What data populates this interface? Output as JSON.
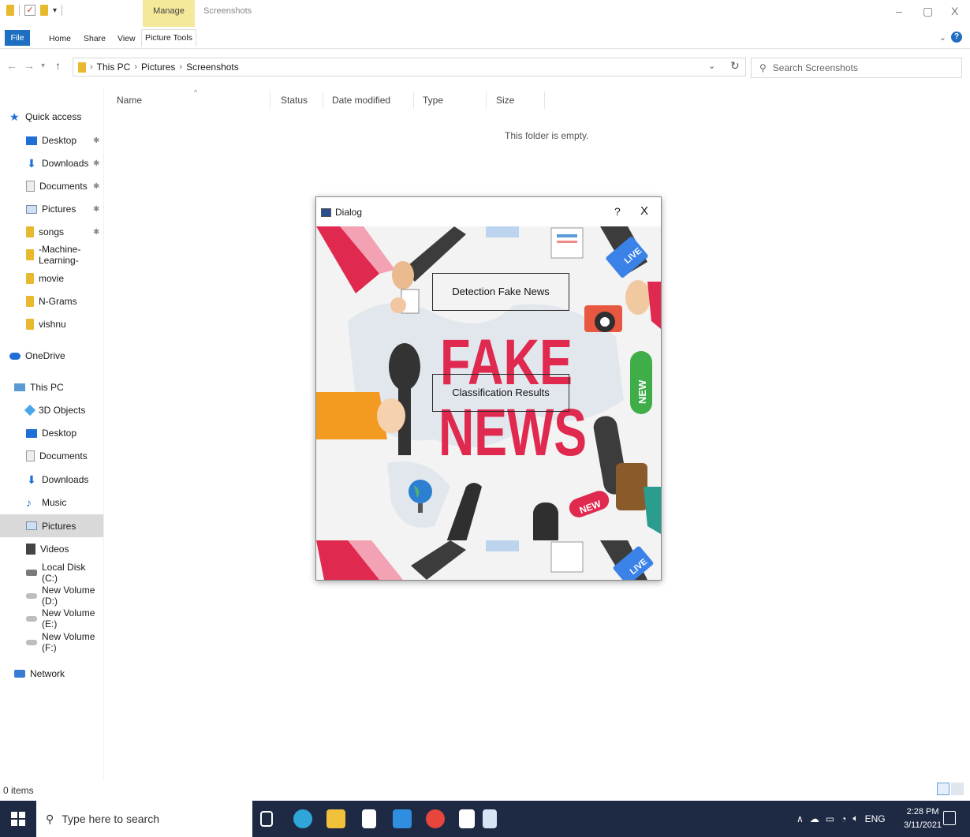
{
  "window": {
    "contextual_tab": "Manage",
    "title": "Screenshots",
    "controls": {
      "minimize": "–",
      "maximize": "▢",
      "close": "X"
    }
  },
  "ribbon": {
    "tabs": [
      "File",
      "Home",
      "Share",
      "View",
      "Picture Tools"
    ],
    "expand_icon": "chevron-down-icon",
    "help_icon": "?"
  },
  "address_bar": {
    "path": [
      "This PC",
      "Pictures",
      "Screenshots"
    ],
    "search_placeholder": "Search Screenshots"
  },
  "sidebar": {
    "quick_access_label": "Quick access",
    "quick_access": [
      {
        "label": "Desktop",
        "icon": "desktop-icon",
        "pinned": true
      },
      {
        "label": "Downloads",
        "icon": "download-icon",
        "pinned": true
      },
      {
        "label": "Documents",
        "icon": "document-icon",
        "pinned": true
      },
      {
        "label": "Pictures",
        "icon": "pictures-icon",
        "pinned": true
      },
      {
        "label": "songs",
        "icon": "folder-icon",
        "pinned": true
      },
      {
        "label": "-Machine-Learning-",
        "icon": "folder-icon",
        "pinned": false
      },
      {
        "label": "movie",
        "icon": "folder-icon",
        "pinned": false
      },
      {
        "label": "N-Grams",
        "icon": "folder-icon",
        "pinned": false
      },
      {
        "label": "vishnu",
        "icon": "folder-icon",
        "pinned": false
      }
    ],
    "onedrive_label": "OneDrive",
    "this_pc_label": "This PC",
    "this_pc": [
      {
        "label": "3D Objects",
        "icon": "3d-objects-icon"
      },
      {
        "label": "Desktop",
        "icon": "desktop-icon"
      },
      {
        "label": "Documents",
        "icon": "document-icon"
      },
      {
        "label": "Downloads",
        "icon": "download-icon"
      },
      {
        "label": "Music",
        "icon": "music-icon"
      },
      {
        "label": "Pictures",
        "icon": "pictures-icon",
        "selected": true
      },
      {
        "label": "Videos",
        "icon": "videos-icon"
      },
      {
        "label": "Local Disk (C:)",
        "icon": "local-disk-icon"
      },
      {
        "label": "New Volume (D:)",
        "icon": "drive-icon"
      },
      {
        "label": "New Volume (E:)",
        "icon": "drive-icon"
      },
      {
        "label": "New Volume (F:)",
        "icon": "drive-icon"
      }
    ],
    "network_label": "Network"
  },
  "file_list": {
    "columns": [
      "Name",
      "Status",
      "Date modified",
      "Type",
      "Size"
    ],
    "empty_message": "This folder is empty."
  },
  "dialog": {
    "title": "Dialog",
    "help": "?",
    "close": "X",
    "buttons": {
      "detect": "Detection Fake News",
      "results": "Classification Results"
    },
    "background_text": [
      "FAKE",
      "NEWS"
    ],
    "badges": [
      "LIVE",
      "NEW"
    ]
  },
  "status_bar": {
    "item_count": "0 items"
  },
  "taskbar": {
    "search_placeholder": "Type here to search",
    "language": "ENG",
    "time": "2:28 PM",
    "date": "3/11/2021"
  },
  "colors": {
    "accent": "#1e6fc2",
    "manage_tab": "#f6e89a",
    "taskbar": "#1e2a44",
    "fake_news_red": "#e0294f",
    "folder": "#e8b82e"
  }
}
